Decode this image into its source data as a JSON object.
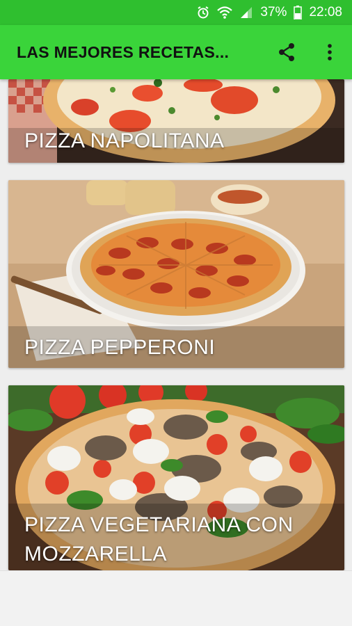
{
  "status_bar": {
    "battery_percent": "37%",
    "time": "22:08",
    "icons": [
      "alarm-icon",
      "wifi-icon",
      "signal-icon",
      "battery-icon"
    ]
  },
  "app_bar": {
    "title": "LAS MEJORES RECETAS...",
    "background": "#3ad43a",
    "actions": [
      "share-icon",
      "more-vert-icon"
    ]
  },
  "recipes": [
    {
      "title": "PIZZA NAPOLITANA"
    },
    {
      "title": "PIZZA PEPPERONI"
    },
    {
      "title": "PIZZA VEGETARIANA CON MOZZARELLA"
    }
  ]
}
